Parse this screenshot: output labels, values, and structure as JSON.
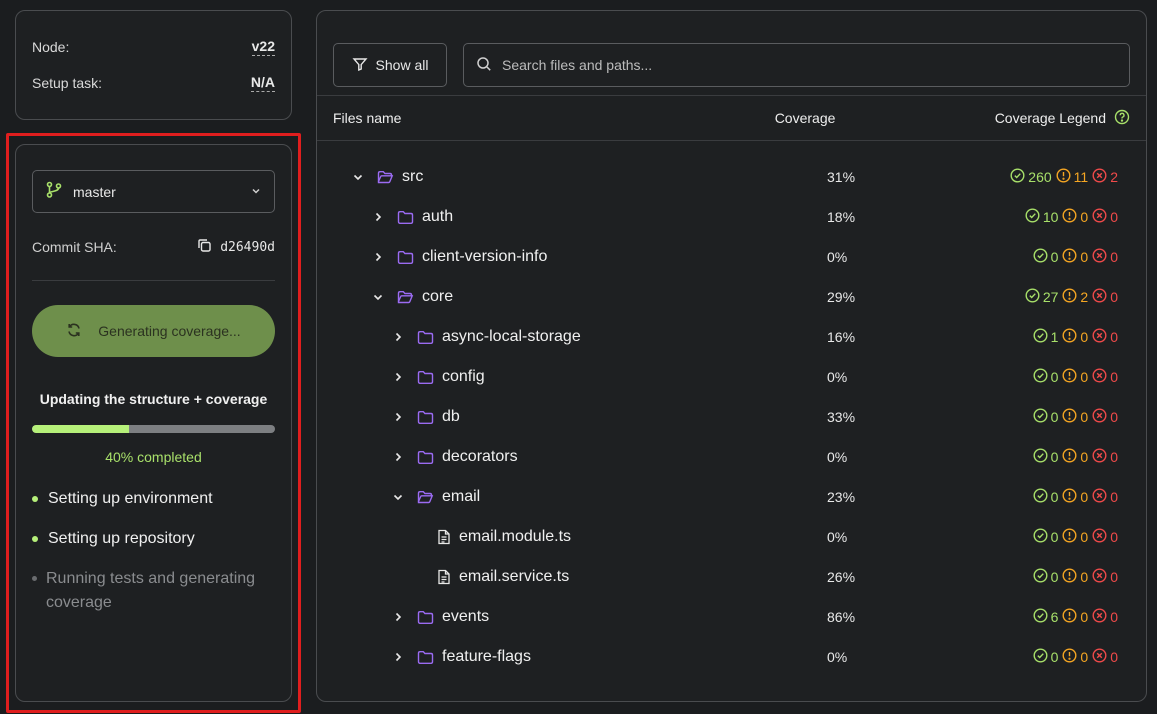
{
  "info": {
    "node_label": "Node:",
    "node_value": "v22",
    "setup_label": "Setup task:",
    "setup_value": "N/A"
  },
  "left": {
    "branch": "master",
    "commit_label": "Commit SHA:",
    "commit_sha": "d26490d",
    "generate_label": "Generating coverage...",
    "update_title": "Updating the structure + coverage",
    "progress_fraction": 0.4,
    "progress_text": "40% completed",
    "steps": [
      {
        "label": "Setting up environment",
        "state": "done"
      },
      {
        "label": "Setting up repository",
        "state": "done"
      },
      {
        "label": "Running tests and generating coverage",
        "state": "pending"
      }
    ]
  },
  "toolbar": {
    "show_all": "Show all",
    "search_placeholder": "Search files and paths..."
  },
  "table": {
    "col_name": "Files name",
    "col_coverage": "Coverage",
    "col_legend": "Coverage Legend",
    "rows": [
      {
        "name": "src",
        "level": 0,
        "type": "folder",
        "expanded": true,
        "coverage": "31%",
        "ok": "260",
        "warn": "11",
        "err": "2"
      },
      {
        "name": "auth",
        "level": 1,
        "type": "folder",
        "expanded": false,
        "coverage": "18%",
        "ok": "10",
        "warn": "0",
        "err": "0"
      },
      {
        "name": "client-version-info",
        "level": 1,
        "type": "folder",
        "expanded": false,
        "coverage": "0%",
        "ok": "0",
        "warn": "0",
        "err": "0"
      },
      {
        "name": "core",
        "level": 1,
        "type": "folder",
        "expanded": true,
        "coverage": "29%",
        "ok": "27",
        "warn": "2",
        "err": "0"
      },
      {
        "name": "async-local-storage",
        "level": 2,
        "type": "folder",
        "expanded": false,
        "coverage": "16%",
        "ok": "1",
        "warn": "0",
        "err": "0"
      },
      {
        "name": "config",
        "level": 2,
        "type": "folder",
        "expanded": false,
        "coverage": "0%",
        "ok": "0",
        "warn": "0",
        "err": "0"
      },
      {
        "name": "db",
        "level": 2,
        "type": "folder",
        "expanded": false,
        "coverage": "33%",
        "ok": "0",
        "warn": "0",
        "err": "0"
      },
      {
        "name": "decorators",
        "level": 2,
        "type": "folder",
        "expanded": false,
        "coverage": "0%",
        "ok": "0",
        "warn": "0",
        "err": "0"
      },
      {
        "name": "email",
        "level": 2,
        "type": "folder",
        "expanded": true,
        "coverage": "23%",
        "ok": "0",
        "warn": "0",
        "err": "0"
      },
      {
        "name": "email.module.ts",
        "level": 3,
        "type": "file",
        "expanded": false,
        "coverage": "0%",
        "ok": "0",
        "warn": "0",
        "err": "0"
      },
      {
        "name": "email.service.ts",
        "level": 3,
        "type": "file",
        "expanded": false,
        "coverage": "26%",
        "ok": "0",
        "warn": "0",
        "err": "0"
      },
      {
        "name": "events",
        "level": 2,
        "type": "folder",
        "expanded": false,
        "coverage": "86%",
        "ok": "6",
        "warn": "0",
        "err": "0"
      },
      {
        "name": "feature-flags",
        "level": 2,
        "type": "folder",
        "expanded": false,
        "coverage": "0%",
        "ok": "0",
        "warn": "0",
        "err": "0"
      }
    ]
  },
  "colors": {
    "ok": "#a8e06a",
    "warn": "#f5a623",
    "err": "#f04a4a",
    "folder": "#9b6bf2",
    "accent": "#6e8f4b"
  }
}
